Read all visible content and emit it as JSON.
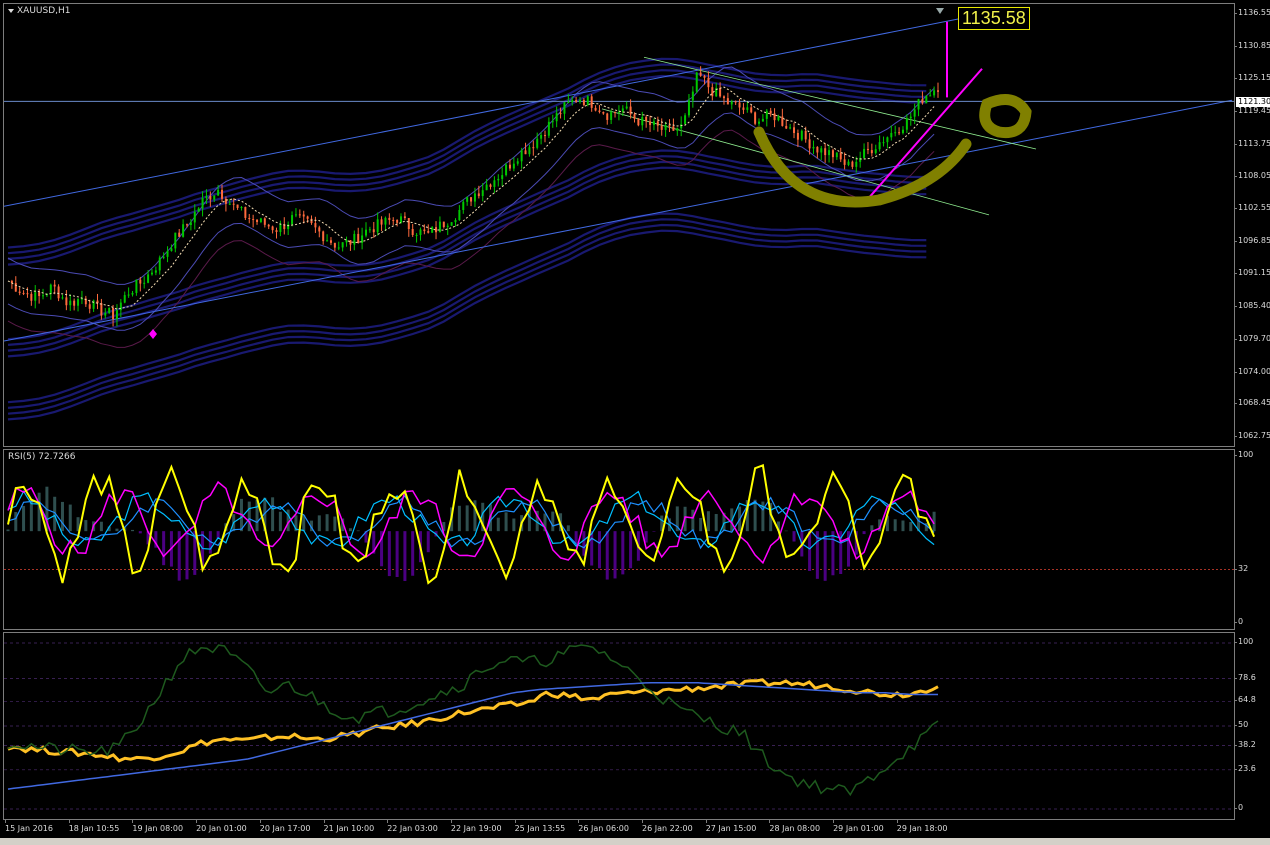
{
  "symbol_title": "XAUUSD,H1",
  "price_tag": "1135.58",
  "current_price": "1121.30",
  "rsi_title": "RSI(5) 72.7266",
  "colors": {
    "bull_candle": "#00c800",
    "bear_candle": "#ff6a3d",
    "envelope": "#191970",
    "channel": "#4169e1",
    "annotation_yellow": "#808000",
    "magenta": "#ff00ff",
    "rsi_yellow": "#ffff00",
    "cyan": "#00bfff",
    "osc_gold": "#ffc125",
    "osc_green": "#1e5a1e"
  },
  "chart_data": [
    {
      "type": "candlestick",
      "title": "XAUUSD,H1",
      "ylim": [
        1062.75,
        1136.55
      ],
      "y_ticks": [
        "1136.55",
        "1130.85",
        "1125.15",
        "1119.45",
        "1113.75",
        "1108.05",
        "1102.55",
        "1096.85",
        "1091.15",
        "1085.40",
        "1079.70",
        "1074.00",
        "1068.45",
        "1062.75"
      ],
      "x_ticks": [
        "15 Jan 2016",
        "18 Jan 10:55",
        "19 Jan 08:00",
        "20 Jan 01:00",
        "20 Jan 17:00",
        "21 Jan 10:00",
        "22 Jan 03:00",
        "22 Jan 19:00",
        "25 Jan 13:55",
        "26 Jan 06:00",
        "26 Jan 22:00",
        "27 Jan 15:00",
        "28 Jan 08:00",
        "29 Jan 01:00",
        "29 Jan 18:00"
      ],
      "close_path": [
        1090,
        1088,
        1087,
        1089,
        1086,
        1087,
        1085,
        1084,
        1088,
        1090,
        1093,
        1097,
        1100,
        1104,
        1106,
        1103,
        1101,
        1100,
        1099,
        1101,
        1100,
        1098,
        1096,
        1097,
        1099,
        1100,
        1101,
        1099,
        1098,
        1100,
        1102,
        1105,
        1107,
        1109,
        1112,
        1114,
        1117,
        1120,
        1122,
        1121,
        1119,
        1120,
        1118,
        1117,
        1116,
        1117,
        1126,
        1123,
        1121,
        1120,
        1118,
        1119,
        1117,
        1115,
        1113,
        1112,
        1110,
        1112,
        1114,
        1116,
        1118,
        1122,
        1124
      ],
      "markers": [
        {
          "label": "current",
          "value": 1121.3
        },
        {
          "label": "spike_high",
          "value": 1135.58
        }
      ]
    },
    {
      "type": "line",
      "title": "RSI(5) 72.7266",
      "ylim": [
        0,
        100
      ],
      "y_ticks": [
        "100",
        "32",
        "0"
      ],
      "level": 32,
      "value": 72.7266
    },
    {
      "type": "line",
      "ylim": [
        0,
        100
      ],
      "y_ticks": [
        "100",
        "78.6",
        "64.8",
        "50",
        "38.2",
        "23.6",
        "0"
      ],
      "series": [
        {
          "color_key": "osc_gold",
          "values": [
            38,
            36,
            35,
            34,
            33,
            31,
            30,
            32,
            35,
            40,
            42,
            41,
            43,
            44,
            42,
            43,
            45,
            48,
            50,
            52,
            55,
            58,
            60,
            62,
            64,
            70,
            68,
            66,
            69,
            70,
            71,
            72,
            73,
            74,
            75,
            76,
            76,
            75,
            74,
            72,
            70,
            69,
            70,
            75
          ]
        },
        {
          "color_key": "osc_green",
          "values": [
            40,
            38,
            36,
            35,
            34,
            36,
            50,
            70,
            90,
            98,
            95,
            85,
            70,
            75,
            68,
            60,
            55,
            58,
            60,
            65,
            70,
            75,
            85,
            90,
            88,
            90,
            95,
            98,
            90,
            80,
            70,
            60,
            55,
            50,
            45,
            30,
            20,
            15,
            12,
            10,
            20,
            30,
            40,
            50
          ]
        },
        {
          "color_key": "channel",
          "values": [
            12,
            14,
            16,
            18,
            20,
            22,
            24,
            26,
            28,
            30,
            34,
            38,
            42,
            46,
            50,
            54,
            58,
            62,
            66,
            70,
            72,
            73,
            74,
            75,
            76,
            76,
            76,
            75,
            74,
            73,
            72,
            71,
            70,
            70,
            69,
            69
          ]
        }
      ]
    }
  ]
}
